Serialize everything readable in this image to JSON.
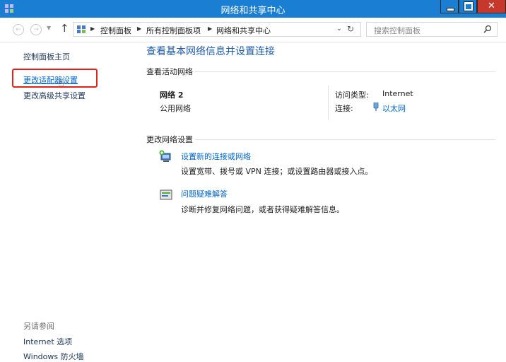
{
  "window": {
    "title": "网络和共享中心"
  },
  "address": {
    "crumbs": [
      "控制面板",
      "所有控制面板项",
      "网络和共享中心"
    ],
    "search_placeholder": "搜索控制面板"
  },
  "leftnav": {
    "home": "控制面板主页",
    "change_adapter": "更改适配器设置",
    "advanced_sharing": "更改高级共享设置",
    "see_also_heading": "另请参阅",
    "internet_options": "Internet 选项",
    "firewall": "Windows 防火墙"
  },
  "main": {
    "title": "查看基本网络信息并设置连接",
    "active_networks_heading": "查看活动网络",
    "network": {
      "name": "网络  2",
      "category": "公用网络",
      "access_type_label": "访问类型:",
      "access_type_value": "Internet",
      "connections_label": "连接:",
      "connections_value": "以太网"
    },
    "change_settings_heading": "更改网络设置",
    "tasks": [
      {
        "title": "设置新的连接或网络",
        "desc": "设置宽带、拨号或 VPN 连接；或设置路由器或接入点。",
        "icon": "new-connection-icon"
      },
      {
        "title": "问题疑难解答",
        "desc": "诊断并修复网络问题，或者获得疑难解答信息。",
        "icon": "troubleshoot-icon"
      }
    ]
  },
  "colors": {
    "titlebar": "#1a7fd3",
    "link": "#0066cc",
    "heading": "#1f5ba8",
    "highlight": "#e2231a"
  }
}
